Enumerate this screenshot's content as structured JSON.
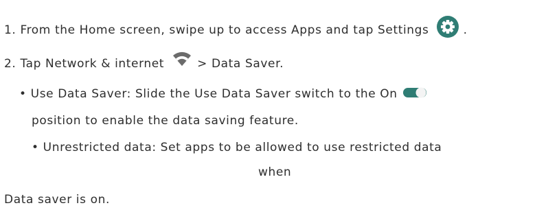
{
  "steps": [
    {
      "number": "1.",
      "text": "From the Home screen, swipe up to access Apps and tap Settings",
      "trailing": ".",
      "icon": "settings-gear-icon"
    },
    {
      "number": "2.",
      "text_before": "Tap Network & internet",
      "text_after": "> Data Saver",
      "trailing": ".",
      "icon": "wifi-icon"
    }
  ],
  "bullets": [
    {
      "bullet": "•",
      "line1": "Use Data Saver: Slide the Use Data Saver switch to the On",
      "line2": "position to enable the data saving feature",
      "trailing": ".",
      "icon": "toggle-on-icon"
    },
    {
      "bullet": "•",
      "line1": "Unrestricted data: Set apps to be allowed to use restricted data",
      "line2": "when",
      "line3": "Data saver is on",
      "trailing": "."
    }
  ],
  "colors": {
    "text": "#2e2e2e",
    "icon_teal": "#2f7d74",
    "icon_grey": "#6b6b6b"
  }
}
